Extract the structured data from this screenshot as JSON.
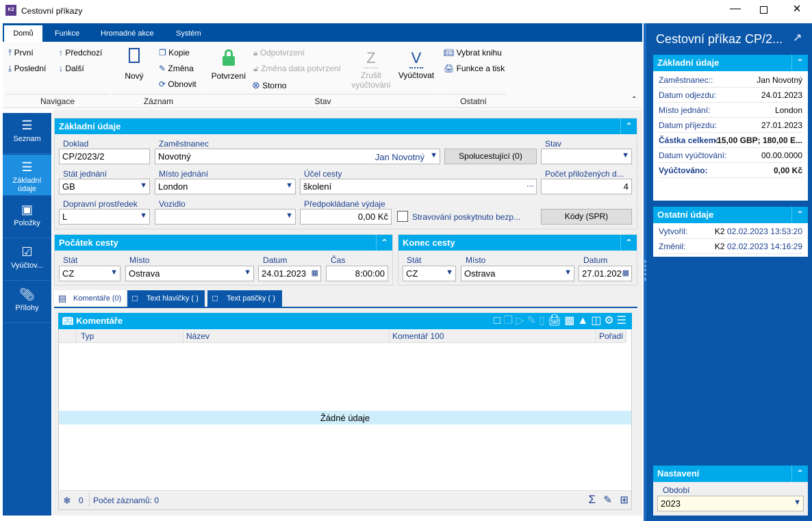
{
  "window": {
    "title": "Cestovní příkazy",
    "logo": "K2",
    "controls": [
      "minimize-icon",
      "maximize-icon",
      "close-icon"
    ]
  },
  "ribbon": {
    "tabs": [
      "Domů",
      "Funkce",
      "Hromadné akce",
      "Systém"
    ],
    "groups": {
      "navigace": {
        "label": "Navigace",
        "items": [
          "První",
          "Předchozí",
          "Poslední",
          "Další"
        ]
      },
      "zaznam": {
        "label": "Záznam",
        "new": "Nový",
        "items": [
          "Kopie",
          "Změna",
          "Obnovit"
        ]
      },
      "stav": {
        "label": "Stav",
        "potvrzeni": "Potvrzení",
        "odpotvrzeni": "Odpotvrzení",
        "zmena_data": "Změna data potvrzení",
        "storno": "Storno",
        "zrusit1": "Zrušit",
        "zrusit2": "vyúčtování",
        "vyuctovat": "Vyúčtovat"
      },
      "ostatni": {
        "label": "Ostatní",
        "items": [
          "Vybrat knihu",
          "Funkce a tisk"
        ]
      }
    }
  },
  "sidebar": {
    "items": [
      {
        "label": "Seznam",
        "icon": "list-icon"
      },
      {
        "label": "Základní údaje",
        "icon": "details-icon",
        "selected": true
      },
      {
        "label": "Položky",
        "icon": "box-icon"
      },
      {
        "label": "Vyúčtov...",
        "icon": "clipboard-icon"
      },
      {
        "label": "Přílohy",
        "icon": "paperclip-icon"
      }
    ]
  },
  "basic": {
    "title": "Základní údaje",
    "doklad": {
      "label": "Doklad",
      "value": "CP/2023/2"
    },
    "zamestnanec": {
      "label": "Zaměstnanec",
      "value": "Novotný",
      "name": "Jan Novotný"
    },
    "spolucestujici": "Spolucestující (0)",
    "stav": {
      "label": "Stav",
      "value": ""
    },
    "stat": {
      "label": "Stát jednání",
      "value": "GB"
    },
    "misto": {
      "label": "Místo jednání",
      "value": "London"
    },
    "ucel": {
      "label": "Účel cesty",
      "value": "školení"
    },
    "pocet": {
      "label": "Počet přiložených d...",
      "value": "4"
    },
    "doprava": {
      "label": "Dopravní prostředek",
      "value": "L"
    },
    "vozidlo": {
      "label": "Vozidlo",
      "value": ""
    },
    "vydaje": {
      "label": "Předpokládané výdaje",
      "value": "0,00 Kč"
    },
    "stravovani": {
      "label": "Stravování poskytnuto bezp...",
      "checked": false
    },
    "kody": "Kódy (SPR)"
  },
  "start": {
    "title": "Počátek cesty",
    "stat": {
      "label": "Stát",
      "value": "CZ"
    },
    "misto": {
      "label": "Místo",
      "value": "Ostrava"
    },
    "datum": {
      "label": "Datum",
      "value": "24.01.2023"
    },
    "cas": {
      "label": "Čas",
      "value": "8:00:00"
    }
  },
  "end": {
    "title": "Konec cesty",
    "stat": {
      "label": "Stát",
      "value": "CZ"
    },
    "misto": {
      "label": "Místo",
      "value": "Ostrava"
    },
    "datum": {
      "label": "Datum",
      "value": "27.01.202"
    }
  },
  "tabs": [
    "Komentáře (0)",
    "Text hlavičky ( )",
    "Text patičky ( )"
  ],
  "grid": {
    "title": "Komentáře",
    "columns": [
      "Typ",
      "Název",
      "Komentář 100",
      "Pořadí"
    ],
    "empty": "Žádné údaje",
    "footer": {
      "count": "0",
      "records": "Počet záznamů: 0"
    }
  },
  "right": {
    "title": "Cestovní příkaz CP/2...",
    "basic": {
      "title": "Základní údaje",
      "rows": [
        {
          "k": "Zaměstnanec::",
          "v": "Jan Novotný"
        },
        {
          "k": "Datum odjezdu:",
          "v": "24.01.2023"
        },
        {
          "k": "Místo jednání:",
          "v": "London"
        },
        {
          "k": "Datum příjezdu:",
          "v": "27.01.2023"
        },
        {
          "k": "Částka celkem:",
          "v": "-15,00 GBP; 180,00 E..."
        },
        {
          "k": "Datum vyúčtování:",
          "v": "00.00.0000"
        },
        {
          "k": "Vyúčtováno:",
          "v": "0,00 Kč"
        }
      ]
    },
    "other": {
      "title": "Ostatní údaje",
      "rows": [
        {
          "k": "Vytvořil:",
          "user": "K2",
          "v": "02.02.2023 13:53:20"
        },
        {
          "k": "Změnil:",
          "user": "K2",
          "v": "02.02.2023 14:16:29"
        }
      ]
    },
    "settings": {
      "title": "Nastavení",
      "obdobi": {
        "label": "Období",
        "value": "2023"
      }
    }
  },
  "colors": {
    "ribbon": "#0050a2",
    "section": "#00a9ea",
    "sidebar": "#0a57aa",
    "selected": "#1e8ee0"
  }
}
